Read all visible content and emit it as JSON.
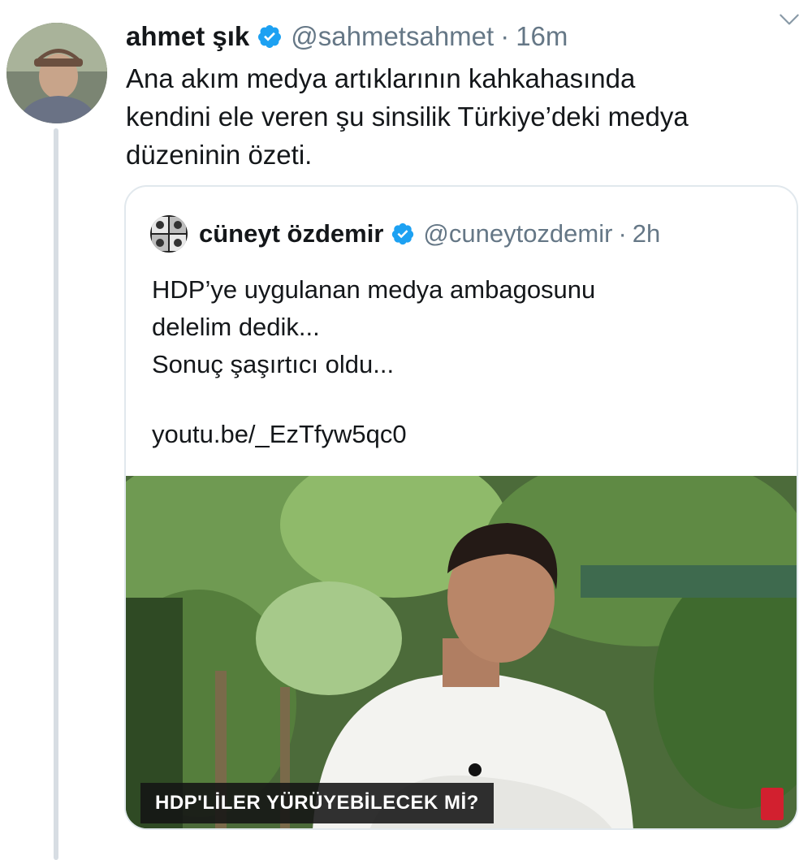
{
  "tweet": {
    "author": {
      "name": "ahmet şık",
      "handle": "@sahmetsahmet",
      "separator": "·",
      "time": "16m",
      "verified": true,
      "avatar_icon": "user-avatar"
    },
    "text_lines": [
      "Ana akım medya artıklarının kahkahasında",
      "kendini ele veren şu sinsilik Türkiye’deki medya",
      "düzeninin özeti."
    ],
    "menu_icon": "chevron-down-icon"
  },
  "quoted_tweet": {
    "author": {
      "name": "cüneyt özdemir",
      "handle": "@cuneytozdemir",
      "separator": "·",
      "time": "2h",
      "verified": true,
      "avatar_icon": "user-avatar"
    },
    "text_lines": [
      "HDP’ye uygulanan medya ambagosunu",
      "delelim dedik...",
      "Sonuç şaşırtıcı oldu..."
    ],
    "link": "youtu.be/_EzTfyw5qc0",
    "video": {
      "caption": "HDP'LİLER YÜRÜYEBİLECEK Mİ?"
    }
  },
  "colors": {
    "verified": "#1da1f2",
    "secondary_text": "#657786",
    "thread_line": "#d7dde3",
    "card_border": "#e1e8ed"
  }
}
